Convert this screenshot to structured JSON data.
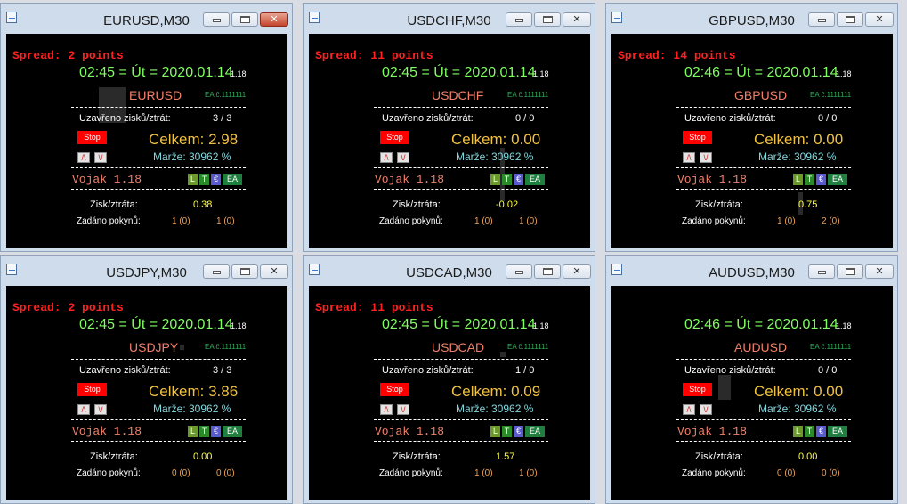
{
  "common": {
    "stop_label": "Stop",
    "arrow_up": "/\\",
    "arrow_down": "\\/",
    "closed_label": "Uzavřeno zisků/ztrát:",
    "pl_label": "Zisk/ztráta:",
    "orders_label": "Zadáno pokynů:",
    "vojak_label": "Vojak  1.18",
    "ea_code": "EA č.1111111",
    "version": "1.18",
    "tags": [
      "L",
      "T",
      "€",
      "EA"
    ]
  },
  "windows": [
    {
      "title": "EURUSD,M30",
      "spread": "Spread: 2 points",
      "timeline": "02:45 = Út = 2020.01.14",
      "symbol": "EURUSD",
      "closed": "3 / 3",
      "total": "Celkem: 2.98",
      "margin": "Marže:  30962 %",
      "pl": "0.38",
      "orders1": "1 (0)",
      "orders2": "1 (0)"
    },
    {
      "title": "USDCHF,M30",
      "spread": "Spread: 11 points",
      "timeline": "02:45 = Út = 2020.01.14",
      "symbol": "USDCHF",
      "closed": "0 / 0",
      "total": "Celkem: 0.00",
      "margin": "Marže:  30962 %",
      "pl": "-0.02",
      "orders1": "1 (0)",
      "orders2": "1 (0)"
    },
    {
      "title": "GBPUSD,M30",
      "spread": "Spread: 14 points",
      "timeline": "02:46 = Út = 2020.01.14",
      "symbol": "GBPUSD",
      "closed": "0 / 0",
      "total": "Celkem: 0.00",
      "margin": "Marže:  30962 %",
      "pl": "0.75",
      "orders1": "1 (0)",
      "orders2": "2 (0)"
    },
    {
      "title": "USDJPY,M30",
      "spread": "Spread: 2 points",
      "timeline": "02:45 = Út = 2020.01.14",
      "symbol": "USDJPY",
      "closed": "3 / 3",
      "total": "Celkem: 3.86",
      "margin": "Marže:  30962 %",
      "pl": "0.00",
      "orders1": "0 (0)",
      "orders2": "0 (0)"
    },
    {
      "title": "USDCAD,M30",
      "spread": "Spread: 11 points",
      "timeline": "02:45 = Út = 2020.01.14",
      "symbol": "USDCAD",
      "closed": "1 / 0",
      "total": "Celkem: 0.09",
      "margin": "Marže:  30962 %",
      "pl": "1.57",
      "orders1": "1 (0)",
      "orders2": "1 (0)"
    },
    {
      "title": "AUDUSD,M30",
      "spread": "",
      "timeline": "02:46 = Út = 2020.01.14",
      "symbol": "AUDUSD",
      "closed": "0 / 0",
      "total": "Celkem: 0.00",
      "margin": "Marže:  30962 %",
      "pl": "0.00",
      "orders1": "0 (0)",
      "orders2": "0 (0)"
    }
  ],
  "colors": {
    "chart_bg": "#000000",
    "spread": "#ff2020",
    "time": "#7fff5f",
    "symbol": "#f0806a",
    "total": "#f0c040",
    "margin": "#7fd8e0",
    "pl": "#ffff40",
    "orders": "#f0a050",
    "stop": "#ff0000",
    "tag_l": "#6a9a2a",
    "tag_t": "#2a8a2a",
    "tag_euro": "#5a5acf",
    "tag_ea": "#1f7f3f"
  }
}
